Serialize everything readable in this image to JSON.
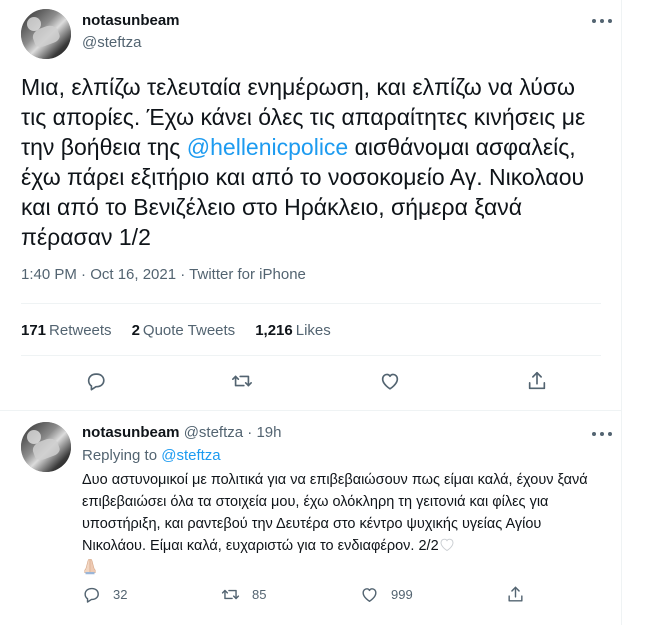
{
  "main_tweet": {
    "display_name": "notasunbeam",
    "handle": "@steftza",
    "text_before_mention": "Μια, ελπίζω τελευταία ενημέρωση, και ελπίζω να λύσω τις απορίες. Έχω κάνει όλες τις απαραίτητες κινήσεις με την βοήθεια της ",
    "mention": "@hellenicpolice",
    "text_after_mention": " αισθάνομαι ασφαλείς, έχω πάρει εξιτήριο και από το νοσοκομείο Αγ. Νικολαου και από το Βενιζέλειο στο Ηράκλειο, σήμερα ξανά πέρασαν 1/2",
    "time": "1:40 PM · Oct 16, 2021 · ",
    "source": "Twitter for iPhone",
    "stats": {
      "retweets_count": "171",
      "retweets_label": "Retweets",
      "quote_count": "2",
      "quote_label": "Quote Tweets",
      "likes_count": "1,216",
      "likes_label": "Likes"
    }
  },
  "reply_tweet": {
    "display_name": "notasunbeam",
    "handle": "@steftza",
    "separator": " · ",
    "time_ago": "19h",
    "replying_prefix": "Replying to ",
    "replying_to": "@steftza",
    "text": "Δυο αστυνομικοί με πολιτικά για να επιβεβαιώσουν πως είμαι καλά, έχουν ξανά επιβεβαιώσει όλα τα στοιχεία μου, έχω ολόκληρη τη γειτονιά και φίλες για υποστήριξη, και ραντεβού την Δευτέρα στο κέντρο ψυχικής υγείας Αγίου Νικολάου. Είμαι καλά, ευχαριστώ για το ενδιαφέρον. 2/2",
    "replies": "32",
    "retweets": "85",
    "likes": "999"
  },
  "icons": [
    "more-icon",
    "reply-icon",
    "retweet-icon",
    "like-icon",
    "share-icon",
    "white-heart-emoji",
    "folded-hands-emoji"
  ],
  "colors": {
    "accent": "#1d9bf0",
    "text": "#0f1419",
    "muted": "#536471",
    "border": "#eff3f4"
  }
}
